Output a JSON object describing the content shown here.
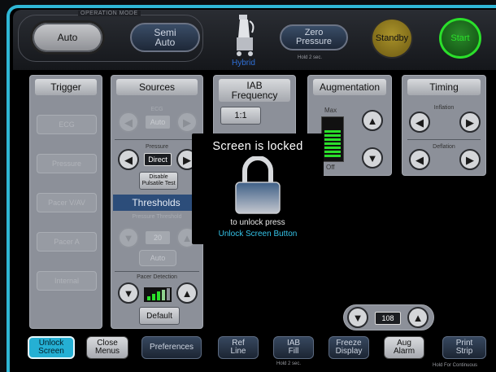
{
  "operation_mode": {
    "label": "OPERATION MODE",
    "auto": "Auto",
    "semi_auto": "Semi\nAuto"
  },
  "device": {
    "name": "Hybrid"
  },
  "zero_pressure": {
    "label": "Zero\nPressure",
    "hint": "Hold 2 sec."
  },
  "standby": "Standby",
  "start": "Start",
  "trigger": {
    "title": "Trigger",
    "options": [
      "ECG",
      "Pressure",
      "Pacer V/AV",
      "Pacer A",
      "Internal"
    ]
  },
  "sources": {
    "title": "Sources",
    "ecg_label": "ECG",
    "ecg_value": "Auto",
    "pressure_label": "Pressure",
    "pressure_value": "Direct",
    "disable_pulsatile": "Disable\nPulsatile Test",
    "thresholds": "Thresholds",
    "pressure_threshold_label": "Pressure Threshold",
    "pressure_threshold_value": "20",
    "auto_button": "Auto",
    "pacer_detection_label": "Pacer Detection",
    "default_button": "Default"
  },
  "iab_frequency": {
    "title": "IAB\nFrequency",
    "value": "1:1"
  },
  "augmentation": {
    "title": "Augmentation",
    "max_label": "Max",
    "off_label": "Off",
    "level_fraction": 0.7
  },
  "timing": {
    "title": "Timing",
    "inflation_label": "Inflation",
    "deflation_label": "Deflation"
  },
  "lock_dialog": {
    "title": "Screen is locked",
    "line1": "to unlock press",
    "line2": "Unlock Screen Button"
  },
  "aug_alarm": {
    "value": "108"
  },
  "bottom": {
    "unlock_screen": "Unlock\nScreen",
    "close_menus": "Close\nMenus",
    "preferences": "Preferences",
    "ref_line": "Ref\nLine",
    "iab_fill": "IAB\nFill",
    "iab_fill_hint": "Hold 2 sec.",
    "freeze_display": "Freeze\nDisplay",
    "aug_alarm": "Aug\nAlarm",
    "print_strip": "Print\nStrip",
    "print_hint": "Hold For Continuous"
  },
  "colors": {
    "accent": "#2fb7d6",
    "start_green": "#2be02b",
    "standby_gold": "#a9922a",
    "thresholds_blue": "#2c4d7a"
  }
}
